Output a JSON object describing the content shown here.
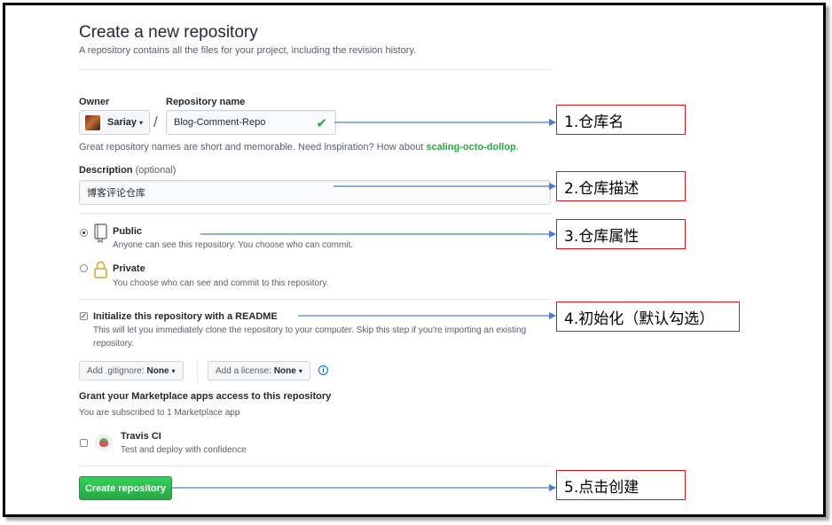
{
  "header": {
    "title": "Create a new repository",
    "subtitle": "A repository contains all the files for your project, including the revision history."
  },
  "owner": {
    "label": "Owner",
    "value": "Sariay",
    "caret": "▾"
  },
  "slash": "/",
  "repo_name": {
    "label": "Repository name",
    "value": "Blog-Comment-Repo",
    "status_icon": "✔"
  },
  "hint": {
    "text": "Great repository names are short and memorable. Need inspiration? How about",
    "suggestion": "scaling-octo-dollop",
    "end": "."
  },
  "description": {
    "label": "Description",
    "optional": "(optional)",
    "value": "博客评论仓库"
  },
  "visibility": {
    "public": {
      "title": "Public",
      "desc": "Anyone can see this repository. You choose who can commit.",
      "selected": true,
      "icon": "repo-icon"
    },
    "private": {
      "title": "Private",
      "desc": "You choose who can see and commit to this repository.",
      "selected": false,
      "icon": "lock-icon"
    }
  },
  "readme": {
    "label": "Initialize this repository with a README",
    "desc_line1": "This will let you immediately clone the repository to your computer. Skip this step if you're importing an existing",
    "desc_line2": "repository.",
    "checked": true,
    "check_glyph": "✓"
  },
  "gitignore": {
    "label": "Add .gitignore:",
    "value": "None",
    "caret": "▾"
  },
  "license": {
    "label": "Add a license:",
    "value": "None",
    "caret": "▾"
  },
  "info_glyph": "i",
  "marketplace": {
    "title": "Grant your Marketplace apps access to this repository",
    "subtitle": "You are subscribed to 1 Marketplace app",
    "app_name": "Travis CI",
    "app_desc": "Test and deploy with confidence",
    "checked": false
  },
  "create_button": "Create repository",
  "annotations": [
    "1.仓库名",
    "2.仓库描述",
    "3.仓库属性",
    "4.初始化（默认勾选）",
    "5.点击创建"
  ],
  "colors": {
    "accent_green": "#28a745",
    "link_blue": "#0366d6",
    "callout_border": "#e0141e",
    "arrow_blue": "#4a7fd4"
  }
}
